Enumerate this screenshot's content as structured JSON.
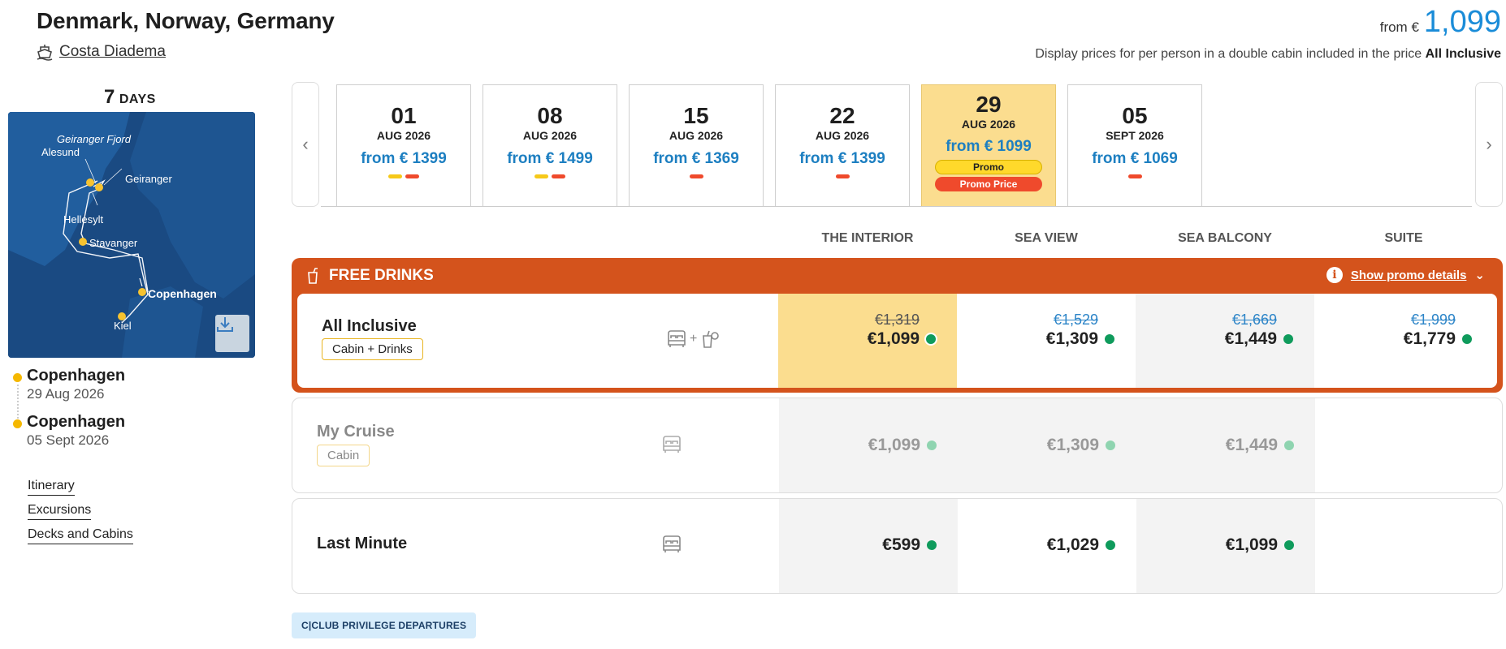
{
  "header": {
    "title": "Denmark, Norway, Germany",
    "ship_name": "Costa Diadema",
    "from_label": "from €",
    "from_price": "1,099",
    "note_prefix": "Display prices for per person in a double cabin included in the price",
    "note_bold": "All Inclusive"
  },
  "left": {
    "days_number": "7",
    "days_label": "DAYS",
    "map_labels": {
      "fjord": "Geiranger Fjord",
      "alesund": "Alesund",
      "geiranger": "Geiranger",
      "hellesylt": "Hellesylt",
      "stavanger": "Stavanger",
      "copenhagen": "Copenhagen",
      "kiel": "Kiel"
    },
    "departure": {
      "port": "Copenhagen",
      "date": "29 Aug 2026"
    },
    "arrival": {
      "port": "Copenhagen",
      "date": "05 Sept 2026"
    },
    "links": [
      "Itinerary",
      "Excursions",
      "Decks and Cabins"
    ]
  },
  "dates": [
    {
      "day": "01",
      "month": "AUG 2026",
      "price": "from € 1399",
      "bars": [
        "y",
        "r"
      ]
    },
    {
      "day": "08",
      "month": "AUG 2026",
      "price": "from € 1499",
      "bars": [
        "y",
        "r"
      ]
    },
    {
      "day": "15",
      "month": "AUG 2026",
      "price": "from € 1369",
      "bars": [
        "r"
      ]
    },
    {
      "day": "22",
      "month": "AUG 2026",
      "price": "from € 1399",
      "bars": [
        "r"
      ]
    },
    {
      "day": "29",
      "month": "AUG 2026",
      "price": "from € 1099",
      "bars": [],
      "selected": true,
      "badge1": "Promo",
      "badge2": "Promo Price"
    },
    {
      "day": "05",
      "month": "SEPT 2026",
      "price": "from € 1069",
      "bars": [
        "r"
      ]
    }
  ],
  "cabins": [
    "THE INTERIOR",
    "SEA VIEW",
    "SEA BALCONY",
    "SUITE"
  ],
  "promo": {
    "title": "FREE DRINKS",
    "details_label": "Show promo details"
  },
  "rows": [
    {
      "name": "All Inclusive",
      "tag": "Cabin + Drinks",
      "icons_plus": "+",
      "old": [
        "€1,319",
        "€1,529",
        "€1,669",
        "€1,999"
      ],
      "prices": [
        "€1,099",
        "€1,309",
        "€1,449",
        "€1,779"
      ]
    },
    {
      "name": "My Cruise",
      "tag": "Cabin",
      "prices": [
        "€1,099",
        "€1,309",
        "€1,449"
      ]
    },
    {
      "name": "Last Minute",
      "prices": [
        "€599",
        "€1,029",
        "€1,099"
      ]
    }
  ],
  "club_label": "C|CLUB PRIVILEGE DEPARTURES",
  "colors": {
    "accent_blue": "#1a8cd8",
    "promo_orange": "#d4531c",
    "selected_yellow": "#fbdd8f",
    "available_green": "#0f9b5c"
  }
}
